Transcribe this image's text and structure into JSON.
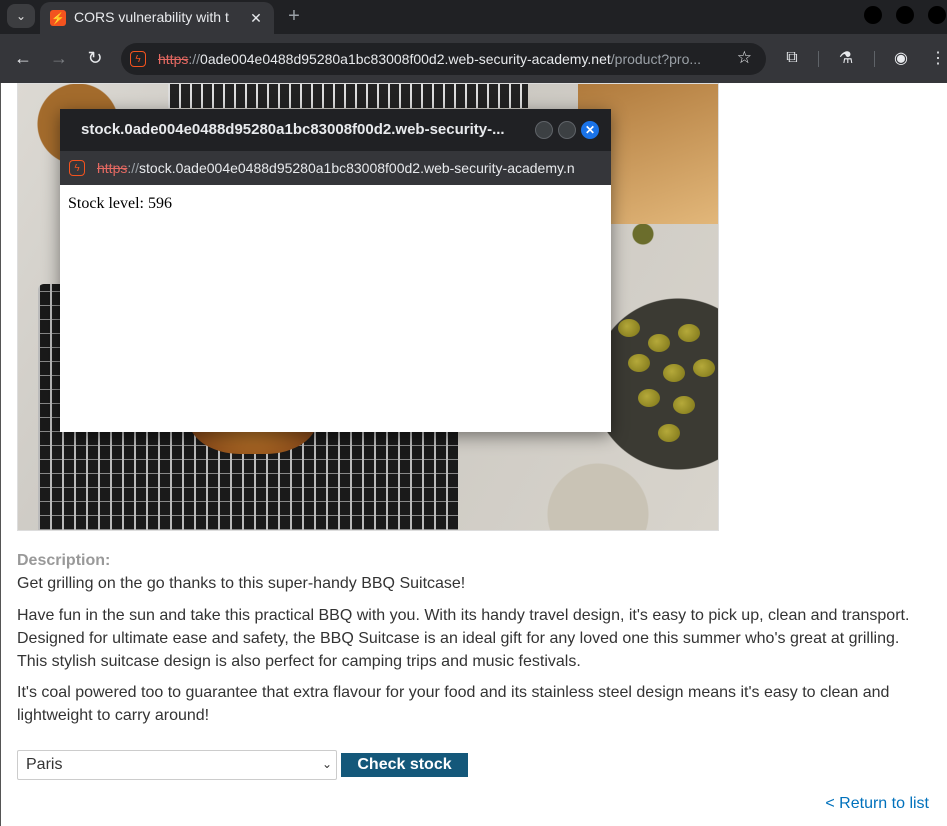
{
  "browser": {
    "tab_title": "CORS vulnerability with t",
    "url_scheme": "https",
    "url_sep": "://",
    "url_host": "0ade004e0488d95280a1bc83008f00d2.web-security-academy.net",
    "url_path": "/product?pro..."
  },
  "icons": {
    "tab_list": "chevron-down-icon",
    "favicon": "lightning-icon",
    "tab_close": "close-icon",
    "new_tab": "plus-icon",
    "back": "arrow-left-icon",
    "forward": "arrow-right-icon",
    "reload": "reload-icon",
    "bookmark": "star-icon",
    "extensions": "puzzle-icon",
    "labs": "flask-icon",
    "profile": "profile-icon",
    "menu": "kebab-menu-icon"
  },
  "popup": {
    "title": "stock.0ade004e0488d95280a1bc83008f00d2.web-security-...",
    "url_scheme": "https",
    "url_sep": "://",
    "url_rest": "stock.0ade004e0488d95280a1bc83008f00d2.web-security-academy.n",
    "stock_text": "Stock level: 596"
  },
  "product": {
    "description_heading": "Description:",
    "paragraphs": [
      "Get grilling on the go thanks to this super-handy BBQ Suitcase!",
      "Have fun in the sun and take this practical BBQ with you. With its handy travel design, it's easy to pick up, clean and transport. Designed for ultimate ease and safety, the BBQ Suitcase is an ideal gift for any loved one this summer who's great at grilling. This stylish suitcase design is also perfect for camping trips and music festivals.",
      "It's coal powered too to guarantee that extra flavour for your food and its stainless steel design means it's easy to clean and lightweight to carry around!"
    ],
    "store_selected": "Paris",
    "check_stock_label": "Check stock",
    "return_link": "< Return to list"
  },
  "colors": {
    "accent": "#14587a",
    "link": "#0071bc",
    "brand": "#f3531f"
  }
}
